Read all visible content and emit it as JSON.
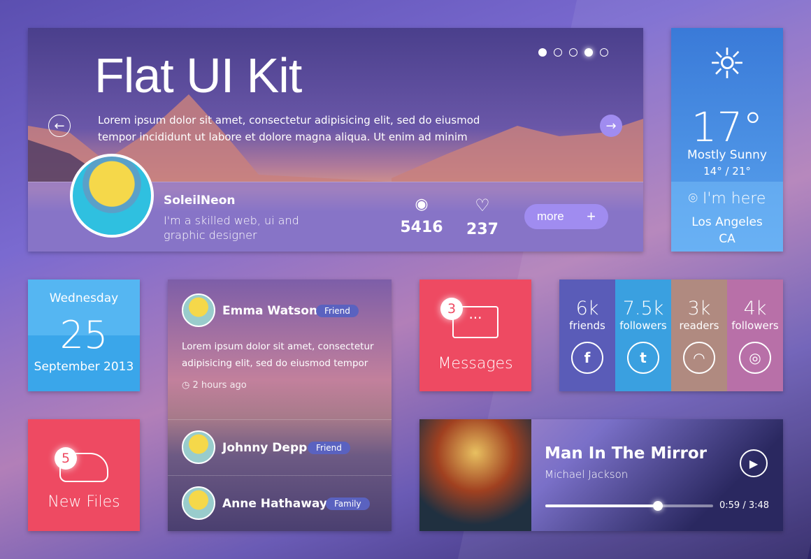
{
  "hero": {
    "title": "Flat UI Kit",
    "text": "Lorem ipsum dolor sit amet, consectetur adipisicing elit, sed do eiusmod tempor incididunt ut labore et dolore magna aliqua. Ut enim ad minim",
    "slides": 5,
    "active_slide": 4,
    "profile": {
      "name": "SoleilNeon",
      "bio": "I'm a skilled web, ui and graphic designer"
    },
    "views": "5416",
    "likes": "237",
    "more_label": "more"
  },
  "weather": {
    "temp": "17°",
    "condition": "Mostly Sunny",
    "range": "14° / 21°",
    "here_label": "I'm here",
    "city": "Los Angeles",
    "state": "CA"
  },
  "date": {
    "weekday": "Wednesday",
    "day": "25",
    "month_year": "September 2013"
  },
  "feed": {
    "items": [
      {
        "name": "Emma Watson",
        "badge": "Friend",
        "text": "Lorem ipsum dolor sit amet, consectetur adipisicing elit, sed do eiusmod tempor",
        "time": "2 hours ago"
      },
      {
        "name": "Johnny Depp",
        "badge": "Friend"
      },
      {
        "name": "Anne Hathaway",
        "badge": "Family"
      }
    ]
  },
  "messages": {
    "count": "3",
    "label": "Messages"
  },
  "social": [
    {
      "value": "6k",
      "label": "friends",
      "icon": "facebook-icon",
      "glyph": "f",
      "color": "#5a5cb8"
    },
    {
      "value": "7.5k",
      "label": "followers",
      "icon": "twitter-icon",
      "glyph": "t",
      "color": "#3aa0e0"
    },
    {
      "value": "3k",
      "label": "readers",
      "icon": "rss-icon",
      "glyph": "◠",
      "color": "#b08a80"
    },
    {
      "value": "4k",
      "label": "followers",
      "icon": "dribbble-icon",
      "glyph": "◎",
      "color": "#b870a8"
    }
  ],
  "files": {
    "count": "5",
    "label": "New Files"
  },
  "player": {
    "title": "Man In The Mirror",
    "artist": "Michael Jackson",
    "time": "0:59 / 3:48",
    "progress": 0.67
  },
  "colors": {
    "accent_red": "#ee4a62",
    "accent_blue": "#3aa6ea",
    "button_purple": "#a08cf0"
  }
}
